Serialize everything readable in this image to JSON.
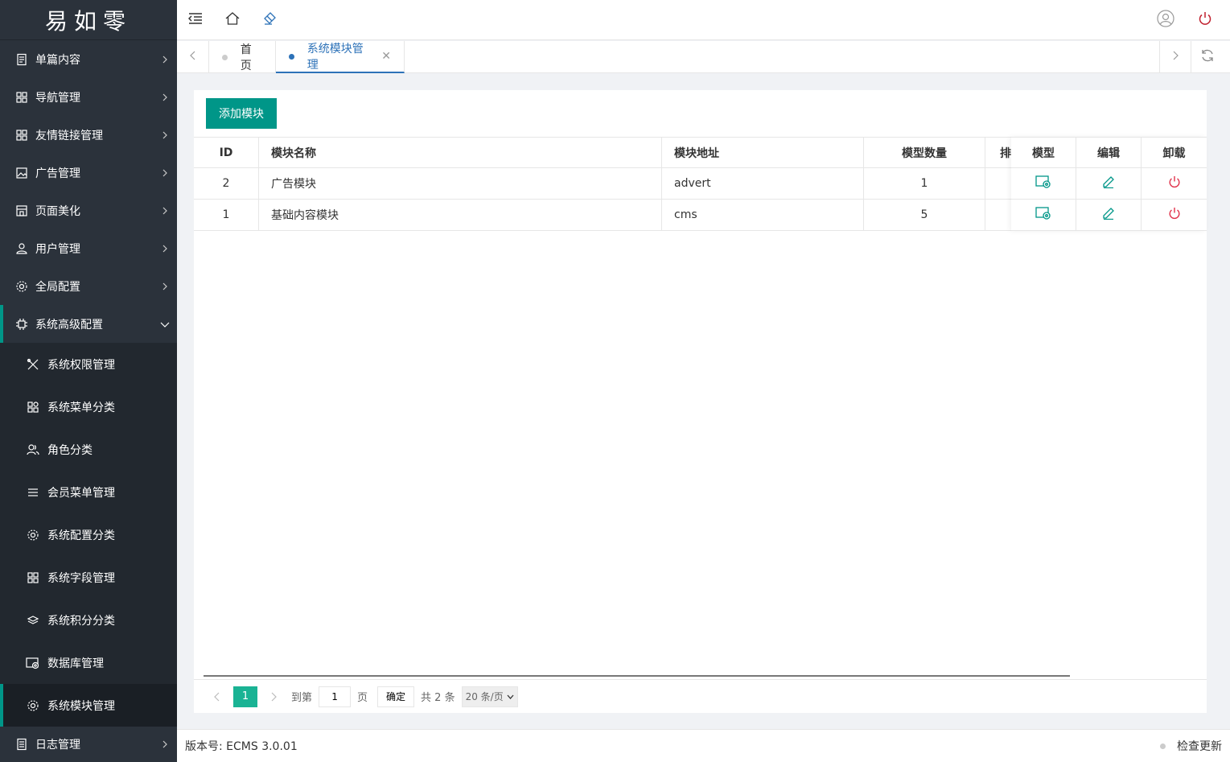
{
  "sidebar": {
    "logo": "易如零",
    "menu": [
      {
        "label": "单篇内容",
        "icon": "document-icon"
      },
      {
        "label": "导航管理",
        "icon": "grid-icon"
      },
      {
        "label": "友情链接管理",
        "icon": "grid-icon"
      },
      {
        "label": "广告管理",
        "icon": "image-icon"
      },
      {
        "label": "页面美化",
        "icon": "store-icon"
      },
      {
        "label": "用户管理",
        "icon": "user-icon"
      },
      {
        "label": "全局配置",
        "icon": "gear-icon"
      },
      {
        "label": "系统高级配置",
        "icon": "chip-icon"
      }
    ],
    "submenu": [
      {
        "label": "系统权限管理",
        "icon": "tools-icon"
      },
      {
        "label": "系统菜单分类",
        "icon": "apps-icon"
      },
      {
        "label": "角色分类",
        "icon": "users-icon"
      },
      {
        "label": "会员菜单管理",
        "icon": "list-icon"
      },
      {
        "label": "系统配置分类",
        "icon": "gear-icon"
      },
      {
        "label": "系统字段管理",
        "icon": "grid-icon"
      },
      {
        "label": "系统积分分类",
        "icon": "layers-icon"
      },
      {
        "label": "数据库管理",
        "icon": "database-icon"
      },
      {
        "label": "系统模块管理",
        "icon": "gear-icon"
      }
    ],
    "bottom": {
      "label": "日志管理",
      "icon": "log-icon"
    }
  },
  "tabs": {
    "items": [
      {
        "label": "首页"
      },
      {
        "label": "系统模块管理"
      }
    ]
  },
  "main": {
    "add_button": "添加模块",
    "columns": {
      "id": "ID",
      "name": "模块名称",
      "address": "模块地址",
      "count": "模型数量",
      "sort": "排",
      "model": "模型",
      "edit": "编辑",
      "uninstall": "卸载"
    },
    "rows": [
      {
        "id": "2",
        "name": "广告模块",
        "address": "advert",
        "count": "1"
      },
      {
        "id": "1",
        "name": "基础内容模块",
        "address": "cms",
        "count": "5"
      }
    ],
    "pager": {
      "current": "1",
      "goto_label": "到第",
      "page_input": "1",
      "page_label": "页",
      "confirm": "确定",
      "total": "共 2 条",
      "page_size": "20 条/页"
    }
  },
  "footer": {
    "version": "版本号: ECMS 3.0.01",
    "check_update": "检查更新"
  },
  "colors": {
    "accent": "#009688",
    "sidebar_bg": "#2b323b",
    "tab_active": "#2d72b8",
    "uninstall": "#e0324b"
  }
}
